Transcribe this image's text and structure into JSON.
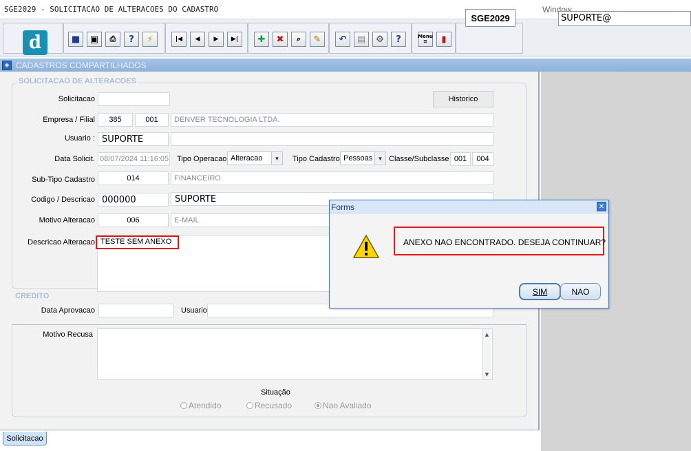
{
  "window": {
    "title": "SGE2029 - SOLICITACAO DE ALTERACOES DO CADASTRO",
    "menu_window": "Window"
  },
  "toolbar": {
    "logo_letter": "d",
    "form_code": "SGE2029",
    "user_value": "SUPORTE@",
    "buttons": [
      {
        "name": "save-icon",
        "glyph": "💾"
      },
      {
        "name": "window-icon",
        "glyph": "▣"
      },
      {
        "name": "print-icon",
        "glyph": "⎙"
      },
      {
        "name": "query-icon",
        "glyph": "?"
      },
      {
        "name": "execute-query-icon",
        "glyph": "⚡"
      },
      {
        "name": "first-record-icon",
        "glyph": "⏮"
      },
      {
        "name": "previous-record-icon",
        "glyph": "◀"
      },
      {
        "name": "next-record-icon",
        "glyph": "▶"
      },
      {
        "name": "last-record-icon",
        "glyph": "⏭"
      },
      {
        "name": "add-record-icon",
        "glyph": "✚"
      },
      {
        "name": "delete-record-icon",
        "glyph": "✖"
      },
      {
        "name": "search-record-icon",
        "glyph": "🔍"
      },
      {
        "name": "edit-record-icon",
        "glyph": "✎"
      },
      {
        "name": "undo-icon",
        "glyph": "↶"
      },
      {
        "name": "clipboard-icon",
        "glyph": "📋"
      },
      {
        "name": "settings-icon",
        "glyph": "⚙"
      },
      {
        "name": "help-icon",
        "glyph": "?"
      },
      {
        "name": "menu-icon",
        "glyph": "☰"
      },
      {
        "name": "exit-icon",
        "glyph": "⇥"
      }
    ],
    "menu_button_label": "Menu"
  },
  "section": {
    "title": "CADASTROS COMPARTILHADOS"
  },
  "form": {
    "group_title": "SOLICITACAO DE ALTERACOES",
    "solicitacao_label": "Solicitacao",
    "solicitacao_value": "",
    "historico_button": "Historico",
    "empresa_label": "Empresa / Filial",
    "empresa_code": "385",
    "filial_code": "001",
    "empresa_name": "DENVER TECNOLOGIA LTDA.",
    "usuario_label": "Usuario :",
    "usuario_value": "SUPORTE",
    "data_label": "Data Solicit.",
    "data_value": "08/07/2024 11:16:05",
    "tipo_operacao_label": "Tipo Operacao",
    "tipo_operacao_value": "Alteracao",
    "tipo_cadastro_label": "Tipo Cadastro",
    "tipo_cadastro_value": "Pessoas",
    "classe_label": "Classe/Subclasse",
    "classe_value": "001",
    "subclasse_value": "004",
    "subtipo_label": "Sub-Tipo Cadastro",
    "subtipo_code": "014",
    "subtipo_desc": "FINANCEIRO",
    "codigo_label": "Codigo / Descricao",
    "codigo_value": "000000",
    "descricao_value": "SUPORTE",
    "motivo_label": "Motivo Alteracao",
    "motivo_code": "006",
    "motivo_desc": "E-MAIL",
    "descricao_alt_label": "Descricao Alteracao",
    "descricao_alt_value": "TESTE SEM ANEXO"
  },
  "credito": {
    "group_title": "CREDITO",
    "data_aprovacao_label": "Data Aprovacao",
    "data_aprovacao_value": "",
    "usuario_label": "Usuario",
    "usuario_value": "",
    "motivo_recusa_label": "Motivo Recusa",
    "motivo_recusa_value": "",
    "situacao_label": "Situação",
    "situacao_options": [
      "Atendido",
      "Recusado",
      "Nao Avaliado"
    ],
    "situacao_selected": "Nao Avaliado"
  },
  "tabs": [
    {
      "label": "Solicitacao",
      "active": true
    }
  ],
  "dialog": {
    "title": "Forms",
    "message": "ANEXO NAO ENCONTRADO. DESEJA CONTINUAR?",
    "yes_button": "SIM",
    "no_button": "NAO",
    "icon": "warning-icon"
  },
  "colors": {
    "section_bar": "#9bbbe0",
    "highlight_box": "#e01818",
    "dialog_border": "#3e78c5",
    "logo": "#1b8fb2"
  }
}
